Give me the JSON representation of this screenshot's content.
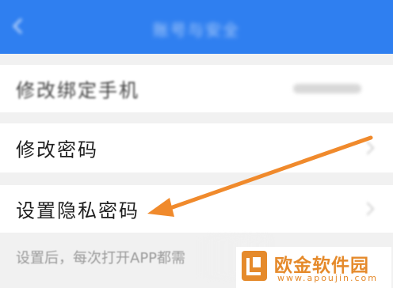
{
  "header": {
    "title": "账号与安全",
    "back_icon": "back-arrow-icon"
  },
  "settings": {
    "bind_phone_label": "修改绑定手机",
    "change_password_label": "修改密码",
    "privacy_password_label": "设置隐私密码",
    "privacy_hint": "设置后，每次打开APP都需"
  },
  "annotation": {
    "arrow_color": "#f08a2c",
    "icon": "pointer-arrow-icon"
  },
  "watermark": {
    "name": "欧金软件园",
    "url": "www.apoujin.com"
  },
  "colors": {
    "header": "#2f7ff0",
    "background": "#f1f1f1",
    "accent": "#e58a2b"
  }
}
